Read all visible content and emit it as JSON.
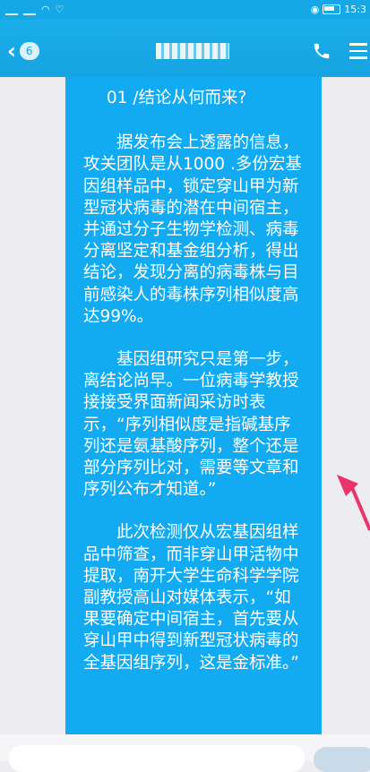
{
  "status_bar": {
    "time": "15:3"
  },
  "nav": {
    "back_badge": "6"
  },
  "message": {
    "heading": "01 /结论从何而来?",
    "paragraphs": [
      "据发布会上透露的信息，攻关团队是从1000 .多份宏基因组样品中，锁定穿山甲为新型冠状病毒的潜在中间宿主，并通过分子生物学检测、病毒分离坚定和基金组分析，得出结论，发现分离的病毒株与目前感染人的毒株序列相似度高达99%。",
      "基因组研究只是第一步，离结论尚早。一位病毒学教授接接受界面新闻采访时表示，“序列相似度是指碱基序列还是氨基酸序列，整个还是部分序列比对，需要等文章和序列公布才知道。”",
      "此次检测仅从宏基因组样品中筛查，而非穿山甲活物中提取，南开大学生命科学学院副教授高山对媒体表示，“如果要确定中间宿主，首先要从穿山甲中得到新型冠状病毒的全基因组序列，这是金标准。”"
    ]
  },
  "colors": {
    "header": "#16a3e1",
    "bubble": "#12aaf0",
    "arrow": "#e8336b"
  }
}
